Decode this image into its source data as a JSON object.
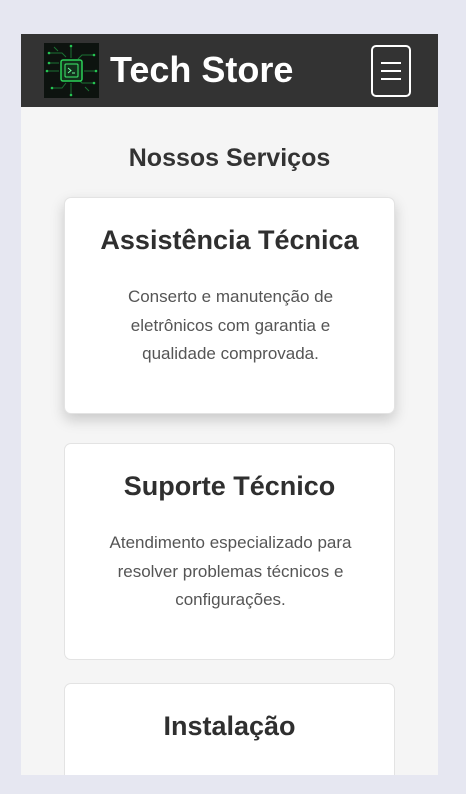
{
  "header": {
    "brand": "Tech Store",
    "logo_icon": "circuit-chip-icon",
    "menu_icon": "hamburger-menu-icon"
  },
  "main": {
    "title": "Nossos Serviços",
    "cards": [
      {
        "title": "Assistência Técnica",
        "description": "Conserto e manutenção de eletrônicos com garantia e qualidade comprovada."
      },
      {
        "title": "Suporte Técnico",
        "description": "Atendimento especializado para resolver problemas técnicos e configurações."
      },
      {
        "title": "Instalação",
        "description": ""
      }
    ]
  },
  "colors": {
    "navbar": "#333333",
    "background": "#f5f5f5",
    "card": "#ffffff",
    "logo_accent": "#2bd158"
  }
}
